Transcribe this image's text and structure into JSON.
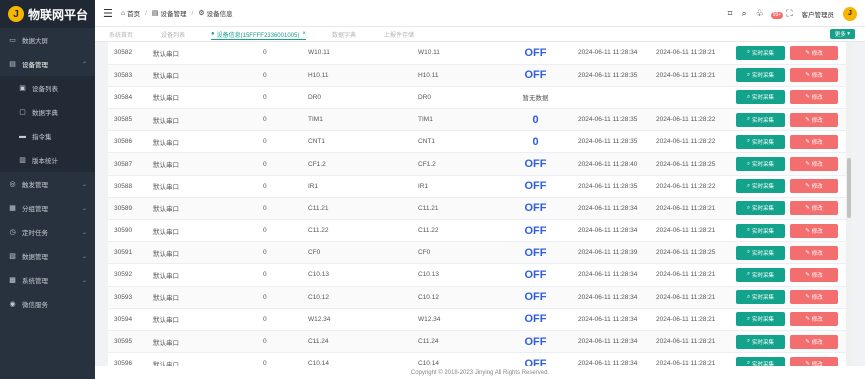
{
  "brand": {
    "logo_char": "J",
    "title": "物联网平台",
    "accent": "#18a08a"
  },
  "sidebar": {
    "items": [
      {
        "label": "数据大屏",
        "icon": "monitor-icon",
        "glyph": "▭",
        "arrow": ""
      },
      {
        "label": "设备管理",
        "icon": "device-icon",
        "glyph": "▤",
        "arrow": "⌃"
      },
      {
        "label": "设备列表",
        "icon": "list-icon",
        "glyph": "▣",
        "arrow": "",
        "sub": true
      },
      {
        "label": "数据字典",
        "icon": "dictionary-icon",
        "glyph": "▢",
        "arrow": "",
        "sub": true
      },
      {
        "label": "指令集",
        "icon": "command-icon",
        "glyph": "▬",
        "arrow": "",
        "sub": true
      },
      {
        "label": "版本统计",
        "icon": "stats-icon",
        "glyph": "▥",
        "arrow": "",
        "sub": true
      },
      {
        "label": "触发管理",
        "icon": "trigger-icon",
        "glyph": "◎",
        "arrow": "⌄"
      },
      {
        "label": "分组管理",
        "icon": "group-icon",
        "glyph": "▦",
        "arrow": "⌄"
      },
      {
        "label": "定时任务",
        "icon": "timer-icon",
        "glyph": "◷",
        "arrow": "⌄"
      },
      {
        "label": "数据管理",
        "icon": "database-icon",
        "glyph": "▧",
        "arrow": "⌄"
      },
      {
        "label": "系统管理",
        "icon": "system-icon",
        "glyph": "▩",
        "arrow": "⌄"
      },
      {
        "label": "微信服务",
        "icon": "wechat-icon",
        "glyph": "◉",
        "arrow": ""
      }
    ]
  },
  "header": {
    "breadcrumb": [
      "首页",
      "设备管理",
      "设备信息"
    ],
    "badge": "99+",
    "user": "客户管理员",
    "avatar_char": "J"
  },
  "tabs": {
    "items": [
      "系统首页",
      "设备列表",
      "设备信息(15FFFF2336001005)",
      "数据字典",
      "上报件存储"
    ],
    "active": 2,
    "close": "×",
    "more": "更多"
  },
  "table": {
    "collect_label": "实时采集",
    "edit_label": "修改",
    "rows": [
      {
        "id": "30582",
        "port": "默认串口",
        "zero": "0",
        "name": "W10.11",
        "name2": "W10.11",
        "value": "OFF",
        "t1": "2024-06-11 11:28:34",
        "t2": "2024-06-11 11:28:21"
      },
      {
        "id": "30583",
        "port": "默认串口",
        "zero": "0",
        "name": "H10.11",
        "name2": "H10.11",
        "value": "OFF",
        "t1": "2024-06-11 11:28:35",
        "t2": "2024-06-11 11:28:21"
      },
      {
        "id": "30584",
        "port": "默认串口",
        "zero": "0",
        "name": "DR0",
        "name2": "DR0",
        "value": "暂无数据",
        "t1": "",
        "t2": ""
      },
      {
        "id": "30585",
        "port": "默认串口",
        "zero": "0",
        "name": "TIM1",
        "name2": "TIM1",
        "value": "0",
        "t1": "2024-06-11 11:28:35",
        "t2": "2024-06-11 11:28:22"
      },
      {
        "id": "30586",
        "port": "默认串口",
        "zero": "0",
        "name": "CNT1",
        "name2": "CNT1",
        "value": "0",
        "t1": "2024-06-11 11:28:35",
        "t2": "2024-06-11 11:28:22"
      },
      {
        "id": "30587",
        "port": "默认串口",
        "zero": "0",
        "name": "CF1.2",
        "name2": "CF1.2",
        "value": "OFF",
        "t1": "2024-06-11 11:28:40",
        "t2": "2024-06-11 11:28:25"
      },
      {
        "id": "30588",
        "port": "默认串口",
        "zero": "0",
        "name": "IR1",
        "name2": "IR1",
        "value": "OFF",
        "t1": "2024-06-11 11:28:35",
        "t2": "2024-06-11 11:28:22"
      },
      {
        "id": "30589",
        "port": "默认串口",
        "zero": "0",
        "name": "C11.21",
        "name2": "C11.21",
        "value": "OFF",
        "t1": "2024-06-11 11:28:34",
        "t2": "2024-06-11 11:28:21"
      },
      {
        "id": "30590",
        "port": "默认串口",
        "zero": "0",
        "name": "C11.22",
        "name2": "C11.22",
        "value": "OFF",
        "t1": "2024-06-11 11:28:34",
        "t2": "2024-06-11 11:28:21"
      },
      {
        "id": "30591",
        "port": "默认串口",
        "zero": "0",
        "name": "CF0",
        "name2": "CF0",
        "value": "OFF",
        "t1": "2024-06-11 11:28:39",
        "t2": "2024-06-11 11:28:25"
      },
      {
        "id": "30592",
        "port": "默认串口",
        "zero": "0",
        "name": "C10.13",
        "name2": "C10.13",
        "value": "OFF",
        "t1": "2024-06-11 11:28:34",
        "t2": "2024-06-11 11:28:21"
      },
      {
        "id": "30593",
        "port": "默认串口",
        "zero": "0",
        "name": "C10.12",
        "name2": "C10.12",
        "value": "OFF",
        "t1": "2024-06-11 11:28:34",
        "t2": "2024-06-11 11:28:21"
      },
      {
        "id": "30594",
        "port": "默认串口",
        "zero": "0",
        "name": "W12.34",
        "name2": "W12.34",
        "value": "OFF",
        "t1": "2024-06-11 11:28:34",
        "t2": "2024-06-11 11:28:21"
      },
      {
        "id": "30595",
        "port": "默认串口",
        "zero": "0",
        "name": "C11.24",
        "name2": "C11.24",
        "value": "OFF",
        "t1": "2024-06-11 11:28:34",
        "t2": "2024-06-11 11:28:21"
      },
      {
        "id": "30596",
        "port": "默认串口",
        "zero": "0",
        "name": "C10.14",
        "name2": "C10.14",
        "value": "OFF",
        "t1": "2024-06-11 11:28:34",
        "t2": "2024-06-11 11:28:21"
      }
    ]
  },
  "footer": {
    "text": "Copyright © 2018-2023 Jinying All Rights Reserved."
  }
}
